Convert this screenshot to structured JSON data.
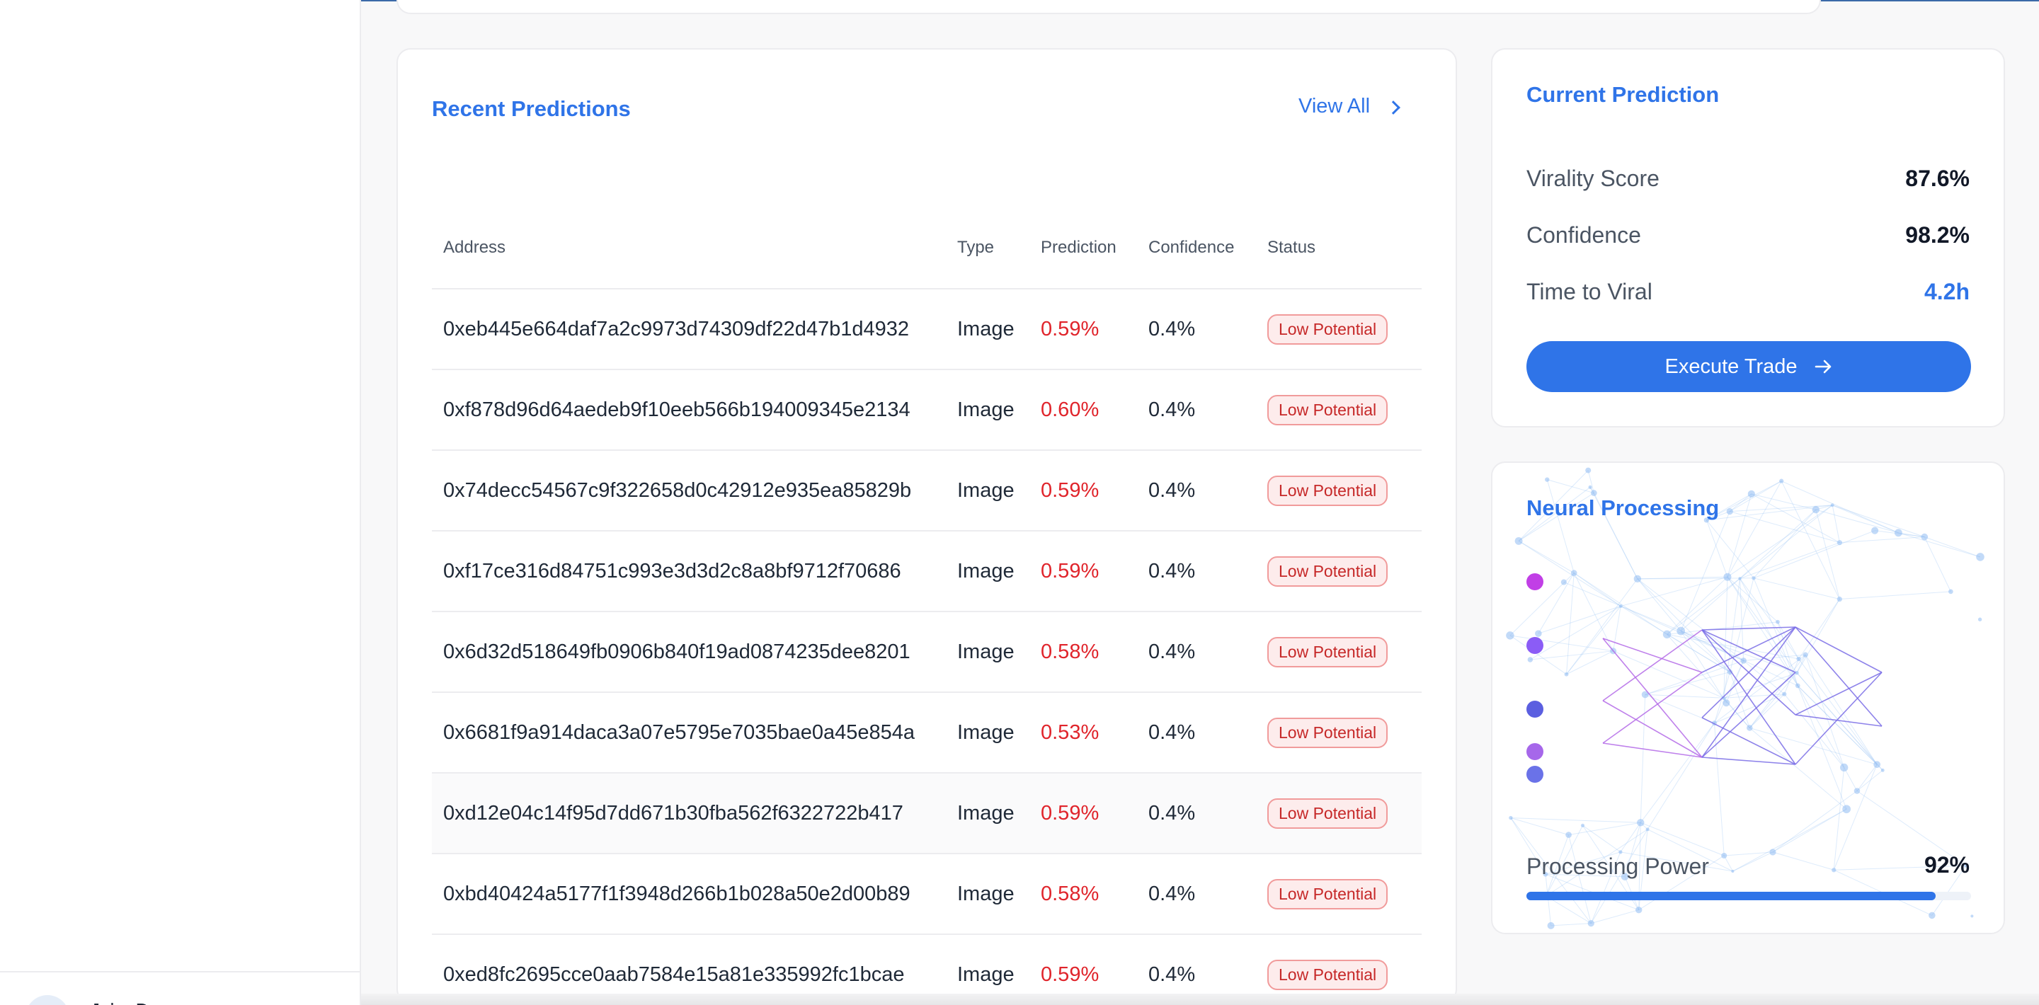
{
  "sidebar": {
    "user_name": "John Doe"
  },
  "predictions": {
    "title": "Recent Predictions",
    "view_all": "View All",
    "columns": [
      "Address",
      "Type",
      "Prediction",
      "Confidence",
      "Status"
    ],
    "rows": [
      {
        "address": "0xeb445e664daf7a2c9973d74309df22d47b1d4932",
        "type": "Image",
        "prediction": "0.59%",
        "confidence": "0.4%",
        "status": "Low Potential"
      },
      {
        "address": "0xf878d96d64aedeb9f10eeb566b194009345e2134",
        "type": "Image",
        "prediction": "0.60%",
        "confidence": "0.4%",
        "status": "Low Potential"
      },
      {
        "address": "0x74decc54567c9f322658d0c42912e935ea85829b",
        "type": "Image",
        "prediction": "0.59%",
        "confidence": "0.4%",
        "status": "Low Potential"
      },
      {
        "address": "0xf17ce316d84751c993e3d3d2c8a8bf9712f70686",
        "type": "Image",
        "prediction": "0.59%",
        "confidence": "0.4%",
        "status": "Low Potential"
      },
      {
        "address": "0x6d32d518649fb0906b840f19ad0874235dee8201",
        "type": "Image",
        "prediction": "0.58%",
        "confidence": "0.4%",
        "status": "Low Potential"
      },
      {
        "address": "0x6681f9a914daca3a07e5795e7035bae0a45e854a",
        "type": "Image",
        "prediction": "0.53%",
        "confidence": "0.4%",
        "status": "Low Potential"
      },
      {
        "address": "0xd12e04c14f95d7dd671b30fba562f6322722b417",
        "type": "Image",
        "prediction": "0.59%",
        "confidence": "0.4%",
        "status": "Low Potential"
      },
      {
        "address": "0xbd40424a5177f1f3948d266b1b028a50e2d00b89",
        "type": "Image",
        "prediction": "0.58%",
        "confidence": "0.4%",
        "status": "Low Potential"
      },
      {
        "address": "0xed8fc2695cce0aab7584e15a81e335992fc1bcae",
        "type": "Image",
        "prediction": "0.59%",
        "confidence": "0.4%",
        "status": "Low Potential"
      }
    ]
  },
  "current": {
    "title": "Current Prediction",
    "metrics": [
      {
        "label": "Virality Score",
        "value": "87.6%"
      },
      {
        "label": "Confidence",
        "value": "98.2%"
      },
      {
        "label": "Time to Viral",
        "value": "4.2h"
      }
    ],
    "execute_label": "Execute Trade"
  },
  "neural": {
    "title": "Neural Processing",
    "power_label": "Processing Power",
    "power_value": "92%",
    "power_fraction": 0.92
  },
  "colors": {
    "accent": "#2f74e8",
    "prediction_red": "#e0242b",
    "badge_red": "#c62828",
    "time_to_viral": "#2f74e8"
  }
}
